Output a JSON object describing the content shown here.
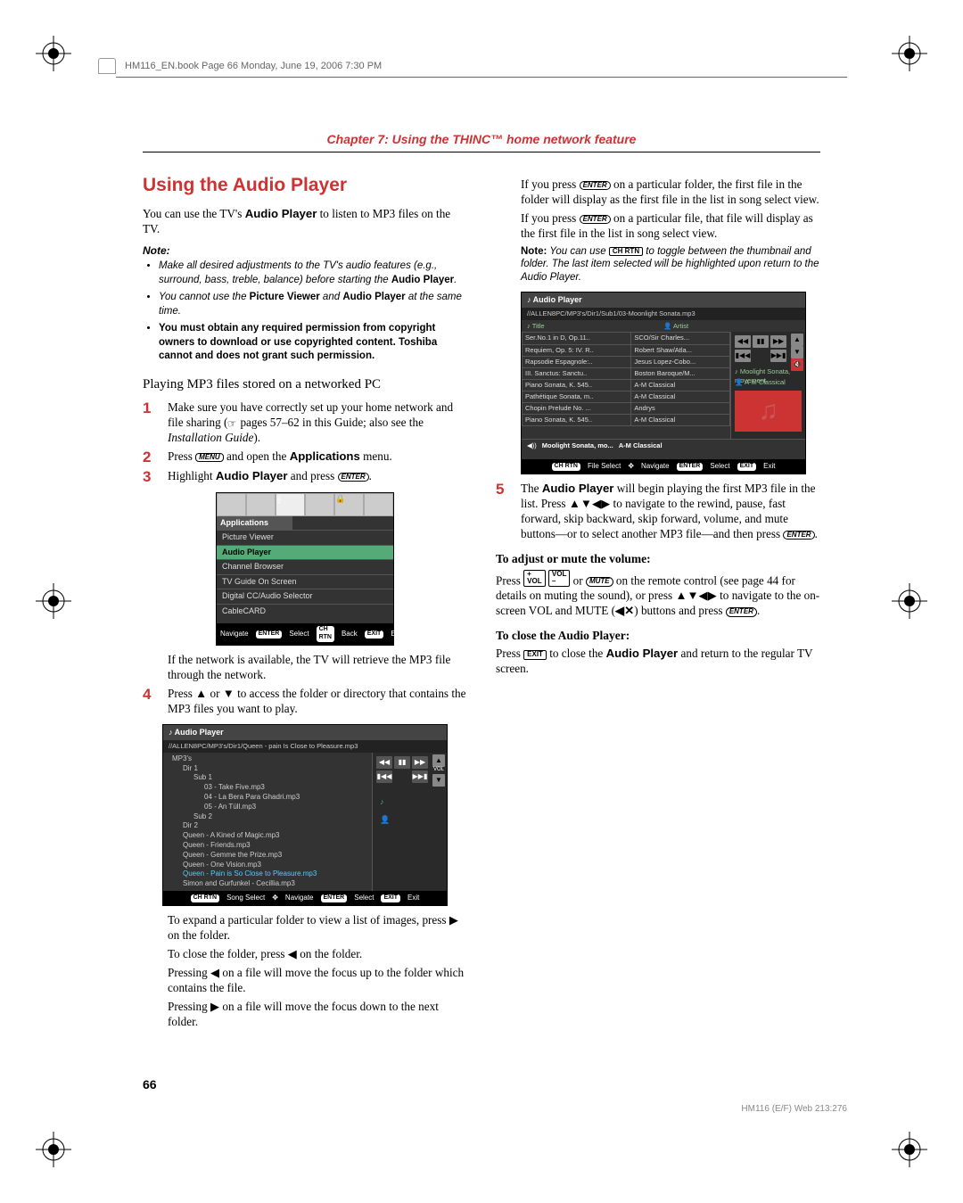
{
  "header_line": "HM116_EN.book  Page 66  Monday, June 19, 2006  7:30 PM",
  "chapter": "Chapter 7: Using the THINC™ home network feature",
  "section_title": "Using the Audio Player",
  "intro_1a": "You can use the TV's ",
  "intro_1b_bold": "Audio Player",
  "intro_1c": " to listen to MP3 files on the TV.",
  "note_label": "Note:",
  "notes": [
    {
      "t1": "Make all desired adjustments to the TV's audio features (e.g., surround, bass, treble, balance) before starting the ",
      "b": "Audio Player",
      "t2": "."
    },
    {
      "t1": "You cannot use the ",
      "b": "Picture Viewer",
      "t2": " and ",
      "b2": "Audio Player",
      "t3": " at the same time."
    },
    {
      "t1": "",
      "b": "You must obtain any required permission from copyright owners to download or use copyrighted content. Toshiba cannot and does not grant such permission.",
      "t2": ""
    }
  ],
  "sub_h": "Playing MP3 files stored on a networked PC",
  "steps": {
    "s1_a": "Make sure you have correctly set up your home network and file sharing (",
    "s1_b": " pages 57–62 in this Guide; also see the ",
    "s1_c_i": "Installation Guide",
    "s1_d": ").",
    "s2_a": "Press ",
    "s2_menu": "MENU",
    "s2_b": " and open the ",
    "s2_bold": "Applications",
    "s2_c": " menu.",
    "s3_a": "Highlight ",
    "s3_bold": "Audio Player",
    "s3_b": " and press ",
    "s3_enter": "ENTER",
    "s3_c": ".",
    "s3_after": "If the network is available, the TV will retrieve the MP3 file through the network.",
    "s4_a": "Press ▲ or ▼ to access the folder or directory that contains the MP3 files you want to play.",
    "s4_after1": "To expand a particular folder to view a list of images, press ▶ on the folder.",
    "s4_after2": "To close the folder, press ◀ on the folder.",
    "s4_after3": "Pressing ◀ on a file will move the focus up to the folder which contains the file.",
    "s4_after4": "Pressing ▶ on a file will move the focus down to the next folder."
  },
  "col2": {
    "p1_a": "If you press ",
    "p1_k": "ENTER",
    "p1_b": " on a particular folder, the first file in the folder will display as the first file in the list in song select view.",
    "p2_a": "If you press ",
    "p2_k": "ENTER",
    "p2_b": " on a particular file, that file will display as the first file in the list in song select view.",
    "noteb_head": "Note:",
    "noteb_a": " You can use ",
    "noteb_k": "CH RTN",
    "noteb_b": " to toggle between the thumbnail and folder. The last item selected will be highlighted upon return to the Audio Player.",
    "s5_a": "The ",
    "s5_bold": "Audio Player",
    "s5_b": " will begin playing the first MP3 file in the list. Press ▲▼◀▶ to navigate to the rewind, pause, fast forward, skip backward, skip forward, volume, and mute buttons—or to select another MP3 file—and then press ",
    "s5_k": "ENTER",
    "s5_c": ".",
    "adj_head": "To adjust or mute the volume:",
    "adj_a": "Press ",
    "adj_k1": "+\nVOL",
    "adj_k2": "VOL\n–",
    "adj_b": " or ",
    "adj_k3": "MUTE",
    "adj_c": " on the remote control (see page 44 for details on muting the sound), or press ▲▼◀▶ to navigate to the on-screen VOL and MUTE (",
    "adj_mute_sym": "🔇",
    "adj_d": ") buttons and press ",
    "adj_k4": "ENTER",
    "adj_e": ".",
    "close_head": "To close the Audio Player:",
    "close_a": "Press ",
    "close_k": "EXIT",
    "close_b": " to close the ",
    "close_bold": "Audio Player",
    "close_c": " and return to the regular TV screen."
  },
  "osd1": {
    "app_label": "Applications",
    "items": [
      "Picture Viewer",
      "Audio Player",
      "Channel Browser",
      "TV Guide On Screen",
      "Digital CC/Audio Selector",
      "CableCARD"
    ],
    "bar": {
      "nav": "Navigate",
      "sel": "Select",
      "back": "Back",
      "exit": "Exit",
      "k_enter": "ENTER",
      "k_chrtn": "CH RTN",
      "k_exit": "EXIT"
    }
  },
  "osd2": {
    "title": "Audio Player",
    "path": "//ALLEN8PC/MP3's/Dir1/Queen - pain Is Close to Pleasure.mp3",
    "tree": [
      {
        "lvl": 0,
        "t": "MP3's"
      },
      {
        "lvl": 1,
        "t": "Dir 1"
      },
      {
        "lvl": 2,
        "t": "Sub 1"
      },
      {
        "lvl": 3,
        "t": "03 - Take Five.mp3"
      },
      {
        "lvl": 3,
        "t": "04 - La Bera Para Ghadri.mp3"
      },
      {
        "lvl": 3,
        "t": "05 - An Tüll.mp3"
      },
      {
        "lvl": 2,
        "t": "Sub 2"
      },
      {
        "lvl": 1,
        "t": "Dir 2"
      },
      {
        "lvl": 1,
        "t": "Queen - A Kined of Magic.mp3"
      },
      {
        "lvl": 1,
        "t": "Queen - Friends.mp3"
      },
      {
        "lvl": 1,
        "t": "Queen - Gemme the Prize.mp3"
      },
      {
        "lvl": 1,
        "t": "Queen - One Vision.mp3"
      },
      {
        "lvl": 1,
        "t": "Queen - Pain is So Close to Pleasure.mp3",
        "sel": true
      },
      {
        "lvl": 1,
        "t": "Simon and Gurfunkel - Cecillia.mp3"
      }
    ],
    "trans": [
      "◀◀",
      "▮▮",
      "▶▶",
      "▮◀◀",
      "",
      "▶▶▮"
    ],
    "vol_up": "▲",
    "vol": "VOL",
    "vol_dn": "▼",
    "mute_ic": "🔇",
    "bar": {
      "song": "Song Select",
      "nav": "Navigate",
      "sel": "Select",
      "exit": "Exit",
      "k_chrtn": "CH RTN",
      "k_enter": "ENTER",
      "k_exit": "EXIT"
    }
  },
  "osd3": {
    "title": "Audio Player",
    "path": "//ALLEN8PC/MP3's/Dir1/Sub1/03-Moonlight Sonata.mp3",
    "col_title": "Title",
    "col_artist": "Artist",
    "rows": [
      [
        "Ser.No.1 in D, Op.11..",
        "SCO/Sir Charles..."
      ],
      [
        "Requiem, Op. 5: IV. R..",
        "Robert Shaw/Atla..."
      ],
      [
        "Rapsodie Espagnole:..",
        "Jesus Lopez-Cobo..."
      ],
      [
        "III. Sanctus: Sanctu..",
        "Boston Baroque/M..."
      ],
      [
        "Piano Sonata, K. 545..",
        "A-M Classical"
      ],
      [
        "Pathétique Sonata, m..",
        "A-M Classical"
      ],
      [
        "Chopin Prelude No. ...",
        "Andrys"
      ],
      [
        "Piano Sonata, K. 545..",
        "A-M Classical"
      ]
    ],
    "now_playing_ic": "◀))",
    "now_title": "Moolight Sonata, mo...",
    "now_artist": "A-M Classical",
    "side_track": "♪ Moolight Sonata, movement",
    "side_artist": "👤 A-M Classical",
    "trans": [
      "◀◀",
      "▮▮",
      "▶▶",
      "▮◀◀",
      "",
      "▶▶▮"
    ],
    "vol_up": "▲",
    "vol": "",
    "vol_dn": "▼",
    "mute_ic": "🔇",
    "bar": {
      "file": "File Select",
      "nav": "Navigate",
      "sel": "Select",
      "exit": "Exit",
      "k_chrtn": "CH RTN",
      "k_enter": "ENTER",
      "k_exit": "EXIT"
    }
  },
  "page_num": "66",
  "footer_code": "HM116 (E/F) Web 213:276"
}
